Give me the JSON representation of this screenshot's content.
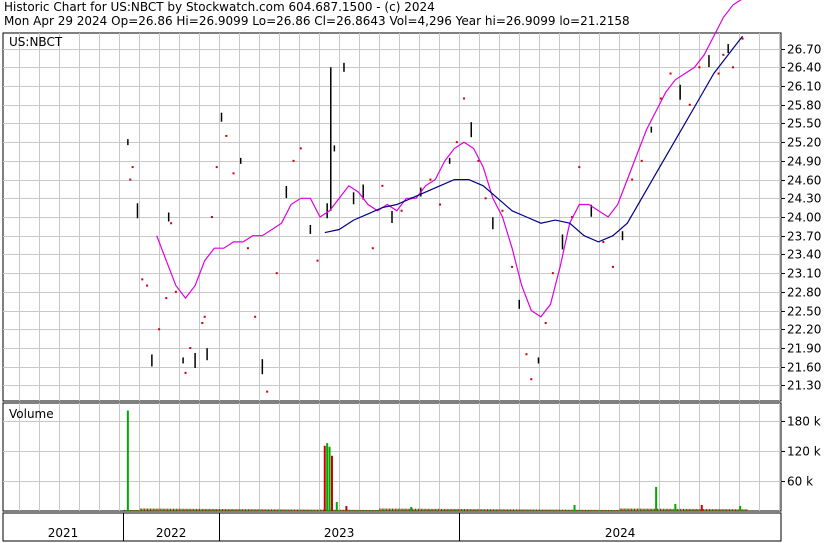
{
  "header": {
    "line1": "Historic Chart for US:NBCT by Stockwatch.com 604.687.1500 - (c) 2024",
    "line2": "Mon Apr 29 2024   Op=26.86   Hi=26.9099   Lo=26.86   Cl=26.8643   Vol=4,296   Year hi=26.9099   lo=21.2158"
  },
  "chart_data": [
    {
      "type": "line",
      "title": "US:NBCT",
      "ylim": [
        21.05,
        26.95
      ],
      "yticks": [
        "26.70",
        "26.40",
        "26.10",
        "25.80",
        "25.50",
        "25.20",
        "24.90",
        "24.60",
        "24.30",
        "24.00",
        "23.70",
        "23.40",
        "23.10",
        "22.80",
        "22.50",
        "22.20",
        "21.90",
        "21.60",
        "21.30"
      ],
      "x_time": {
        "start": 2021.1,
        "end": 2024.34
      },
      "x_year_labels": [
        "2021",
        "2022",
        "2023",
        "2024"
      ],
      "x_year_boundaries": [
        2021.6,
        2022.0,
        2023.0
      ],
      "price_points": [
        [
          2021.62,
          25.2
        ],
        [
          2021.63,
          24.6
        ],
        [
          2021.64,
          24.8
        ],
        [
          2021.66,
          24.1
        ],
        [
          2021.68,
          23.0
        ],
        [
          2021.7,
          22.9
        ],
        [
          2021.72,
          21.7
        ],
        [
          2021.75,
          22.2
        ],
        [
          2021.78,
          22.7
        ],
        [
          2021.79,
          24.0
        ],
        [
          2021.8,
          23.9
        ],
        [
          2021.82,
          22.8
        ],
        [
          2021.85,
          21.7
        ],
        [
          2021.86,
          21.5
        ],
        [
          2021.88,
          21.9
        ],
        [
          2021.9,
          21.7
        ],
        [
          2021.93,
          22.3
        ],
        [
          2021.94,
          22.4
        ],
        [
          2021.95,
          21.8
        ],
        [
          2021.97,
          24.0
        ],
        [
          2021.99,
          24.8
        ],
        [
          2022.01,
          25.6
        ],
        [
          2022.03,
          25.3
        ],
        [
          2022.06,
          24.7
        ],
        [
          2022.09,
          24.9
        ],
        [
          2022.12,
          23.5
        ],
        [
          2022.15,
          22.4
        ],
        [
          2022.18,
          21.6
        ],
        [
          2022.2,
          21.2
        ],
        [
          2022.24,
          23.1
        ],
        [
          2022.28,
          24.4
        ],
        [
          2022.31,
          24.9
        ],
        [
          2022.34,
          25.1
        ],
        [
          2022.38,
          23.8
        ],
        [
          2022.41,
          23.3
        ],
        [
          2022.45,
          24.1
        ],
        [
          2022.48,
          25.1
        ],
        [
          2022.52,
          26.4
        ],
        [
          2022.56,
          24.3
        ],
        [
          2022.6,
          24.4
        ],
        [
          2022.64,
          23.5
        ],
        [
          2022.68,
          24.5
        ],
        [
          2022.72,
          24.0
        ],
        [
          2022.76,
          24.1
        ],
        [
          2022.8,
          24.3
        ],
        [
          2022.84,
          24.4
        ],
        [
          2022.88,
          24.6
        ],
        [
          2022.92,
          24.2
        ],
        [
          2022.96,
          24.9
        ],
        [
          2022.99,
          25.2
        ],
        [
          2023.02,
          25.9
        ],
        [
          2023.05,
          25.4
        ],
        [
          2023.08,
          24.9
        ],
        [
          2023.11,
          24.3
        ],
        [
          2023.14,
          23.9
        ],
        [
          2023.18,
          24.1
        ],
        [
          2023.22,
          23.2
        ],
        [
          2023.25,
          22.6
        ],
        [
          2023.28,
          21.8
        ],
        [
          2023.3,
          21.4
        ],
        [
          2023.33,
          21.7
        ],
        [
          2023.36,
          22.3
        ],
        [
          2023.39,
          23.1
        ],
        [
          2023.43,
          23.6
        ],
        [
          2023.47,
          24.0
        ],
        [
          2023.5,
          24.8
        ],
        [
          2023.55,
          24.1
        ],
        [
          2023.6,
          23.6
        ],
        [
          2023.64,
          23.2
        ],
        [
          2023.68,
          23.7
        ],
        [
          2023.72,
          24.6
        ],
        [
          2023.76,
          24.9
        ],
        [
          2023.8,
          25.4
        ],
        [
          2023.84,
          25.9
        ],
        [
          2023.88,
          26.3
        ],
        [
          2023.92,
          26.0
        ],
        [
          2023.96,
          25.8
        ],
        [
          2024.0,
          26.4
        ],
        [
          2024.04,
          26.5
        ],
        [
          2024.08,
          26.3
        ],
        [
          2024.1,
          26.6
        ],
        [
          2024.12,
          26.7
        ],
        [
          2024.14,
          26.4
        ],
        [
          2024.18,
          26.86
        ]
      ],
      "ma_short": [
        [
          2021.74,
          23.7
        ],
        [
          2021.78,
          23.3
        ],
        [
          2021.82,
          22.9
        ],
        [
          2021.86,
          22.7
        ],
        [
          2021.9,
          22.9
        ],
        [
          2021.94,
          23.3
        ],
        [
          2021.98,
          23.5
        ],
        [
          2022.02,
          23.5
        ],
        [
          2022.06,
          23.6
        ],
        [
          2022.1,
          23.6
        ],
        [
          2022.14,
          23.7
        ],
        [
          2022.18,
          23.7
        ],
        [
          2022.22,
          23.8
        ],
        [
          2022.26,
          23.9
        ],
        [
          2022.3,
          24.2
        ],
        [
          2022.34,
          24.3
        ],
        [
          2022.38,
          24.3
        ],
        [
          2022.42,
          24.0
        ],
        [
          2022.46,
          24.1
        ],
        [
          2022.5,
          24.3
        ],
        [
          2022.54,
          24.5
        ],
        [
          2022.58,
          24.4
        ],
        [
          2022.62,
          24.2
        ],
        [
          2022.66,
          24.1
        ],
        [
          2022.7,
          24.2
        ],
        [
          2022.74,
          24.1
        ],
        [
          2022.78,
          24.3
        ],
        [
          2022.82,
          24.3
        ],
        [
          2022.86,
          24.5
        ],
        [
          2022.9,
          24.6
        ],
        [
          2022.94,
          24.9
        ],
        [
          2022.98,
          25.1
        ],
        [
          2023.02,
          25.2
        ],
        [
          2023.06,
          25.1
        ],
        [
          2023.1,
          24.8
        ],
        [
          2023.14,
          24.3
        ],
        [
          2023.18,
          24.0
        ],
        [
          2023.22,
          23.5
        ],
        [
          2023.26,
          22.9
        ],
        [
          2023.3,
          22.5
        ],
        [
          2023.34,
          22.4
        ],
        [
          2023.38,
          22.6
        ],
        [
          2023.42,
          23.2
        ],
        [
          2023.46,
          23.9
        ],
        [
          2023.5,
          24.2
        ],
        [
          2023.54,
          24.2
        ],
        [
          2023.58,
          24.1
        ],
        [
          2023.62,
          24.0
        ],
        [
          2023.66,
          24.2
        ],
        [
          2023.7,
          24.6
        ],
        [
          2023.74,
          25.0
        ],
        [
          2023.78,
          25.4
        ],
        [
          2023.82,
          25.7
        ],
        [
          2023.86,
          26.0
        ],
        [
          2023.9,
          26.2
        ],
        [
          2023.94,
          26.3
        ],
        [
          2023.98,
          26.4
        ],
        [
          2024.02,
          26.6
        ],
        [
          2024.06,
          26.9
        ],
        [
          2024.1,
          27.2
        ],
        [
          2024.14,
          27.4
        ],
        [
          2024.18,
          27.5
        ]
      ],
      "ma_long": [
        [
          2022.44,
          23.75
        ],
        [
          2022.5,
          23.8
        ],
        [
          2022.56,
          23.95
        ],
        [
          2022.62,
          24.05
        ],
        [
          2022.68,
          24.15
        ],
        [
          2022.74,
          24.2
        ],
        [
          2022.8,
          24.3
        ],
        [
          2022.86,
          24.4
        ],
        [
          2022.92,
          24.5
        ],
        [
          2022.98,
          24.6
        ],
        [
          2023.04,
          24.6
        ],
        [
          2023.1,
          24.5
        ],
        [
          2023.16,
          24.3
        ],
        [
          2023.22,
          24.1
        ],
        [
          2023.28,
          24.0
        ],
        [
          2023.34,
          23.9
        ],
        [
          2023.4,
          23.95
        ],
        [
          2023.46,
          23.9
        ],
        [
          2023.52,
          23.7
        ],
        [
          2023.58,
          23.6
        ],
        [
          2023.64,
          23.7
        ],
        [
          2023.7,
          23.9
        ],
        [
          2023.76,
          24.3
        ],
        [
          2023.82,
          24.7
        ],
        [
          2023.88,
          25.1
        ],
        [
          2023.94,
          25.5
        ],
        [
          2024.0,
          25.9
        ],
        [
          2024.06,
          26.3
        ],
        [
          2024.12,
          26.6
        ],
        [
          2024.18,
          26.9
        ]
      ]
    },
    {
      "type": "bar",
      "title": "Volume",
      "ylim": [
        0,
        215
      ],
      "yticks": [
        "180 k",
        "120 k",
        "60 k"
      ],
      "tick_values": [
        180,
        120,
        60
      ],
      "spikes": [
        {
          "t": 2021.62,
          "v": 200,
          "color": "#0a0"
        },
        {
          "t": 2022.44,
          "v": 130,
          "color": "#c00"
        },
        {
          "t": 2022.45,
          "v": 135,
          "color": "#0a0"
        },
        {
          "t": 2022.46,
          "v": 128,
          "color": "#0a0"
        },
        {
          "t": 2022.47,
          "v": 110,
          "color": "#c00"
        },
        {
          "t": 2022.49,
          "v": 18,
          "color": "#0a0"
        },
        {
          "t": 2022.53,
          "v": 10,
          "color": "#c00"
        },
        {
          "t": 2022.8,
          "v": 8,
          "color": "#0a0"
        },
        {
          "t": 2023.48,
          "v": 12,
          "color": "#0a0"
        },
        {
          "t": 2023.82,
          "v": 48,
          "color": "#0a0"
        },
        {
          "t": 2023.9,
          "v": 14,
          "color": "#0a0"
        },
        {
          "t": 2024.01,
          "v": 12,
          "color": "#c00"
        },
        {
          "t": 2024.17,
          "v": 10,
          "color": "#0a0"
        }
      ]
    }
  ],
  "colors": {
    "grid": "#c8c8c8",
    "ma_short": "#e000e0",
    "ma_long": "#00008b",
    "price_black": "#000000",
    "price_red": "#d00000"
  }
}
